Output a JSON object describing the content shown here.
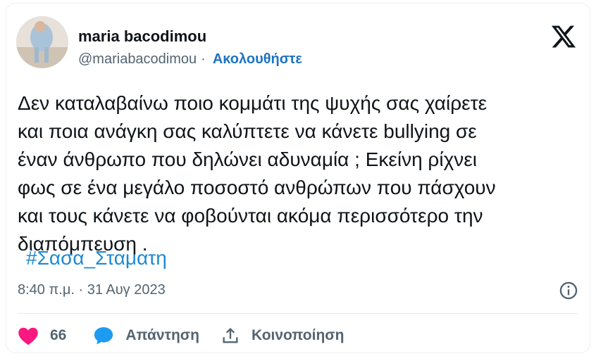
{
  "author": {
    "display_name": "maria bacodimou",
    "handle": "@mariabacodimou",
    "separator": "·",
    "follow_label": "Ακολουθήστε"
  },
  "tweet": {
    "text": "Δεν καταλαβαίνω ποιο κομμάτι της ψυχής σας χαίρετε\nκαι ποια ανάγκη σας καλύπτετε να κάνετε bullying σε\nέναν άνθρωπο που δηλώνει αδυναμία ; Εκείνη ρίχνει\nφως σε ένα μεγάλο ποσοστό ανθρώπων που πάσχουν\nκαι τους κάνετε να φοβούνται ακόμα περισσότερο την\nδιαπόμπευση .",
    "hashtag": "#Σασα_Σταματη",
    "timestamp": "8:40 π.μ. · 31 Αυγ 2023"
  },
  "actions": {
    "likes": "66",
    "reply_label": "Απάντηση",
    "share_label": "Κοινοποίηση"
  },
  "icons": {
    "like": "heart-icon",
    "reply": "speech-bubble-icon",
    "share": "share-icon",
    "info": "info-icon",
    "logo": "x-logo-icon"
  },
  "colors": {
    "like": "#f91880",
    "reply": "#1d9bf0",
    "link": "#1d73c3",
    "hashtag": "#1d8ad2",
    "muted": "#536471"
  }
}
